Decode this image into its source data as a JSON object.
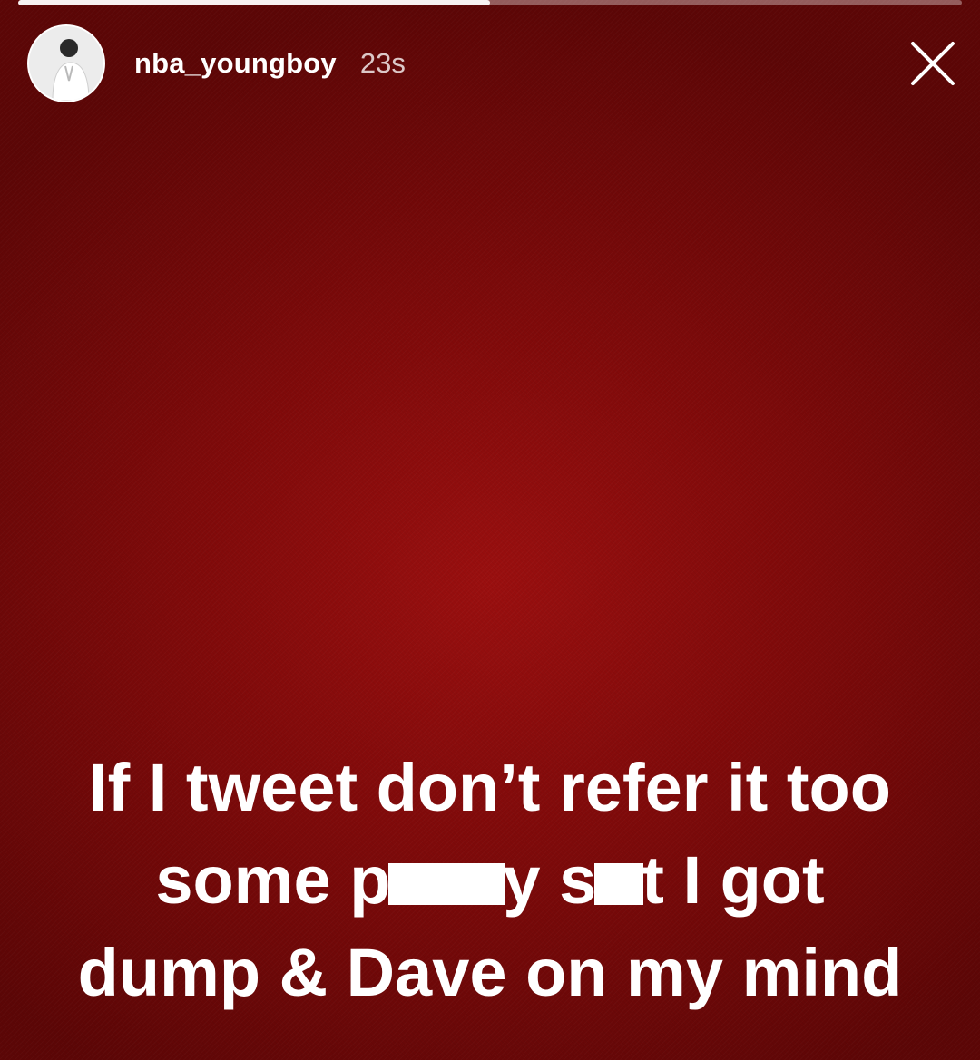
{
  "story": {
    "background_color": "#8a0c0c",
    "progress": 0.5
  },
  "header": {
    "username": "nba_youngboy",
    "time_ago": "23s",
    "avatar_icon": "user-avatar",
    "close_icon": "close-icon"
  },
  "caption": {
    "line1": "If I tweet don’t refer it too",
    "line2_a": "some p",
    "line2_b": "y s",
    "line2_c": "t I got",
    "line3": "dump & Dave on my mind"
  }
}
